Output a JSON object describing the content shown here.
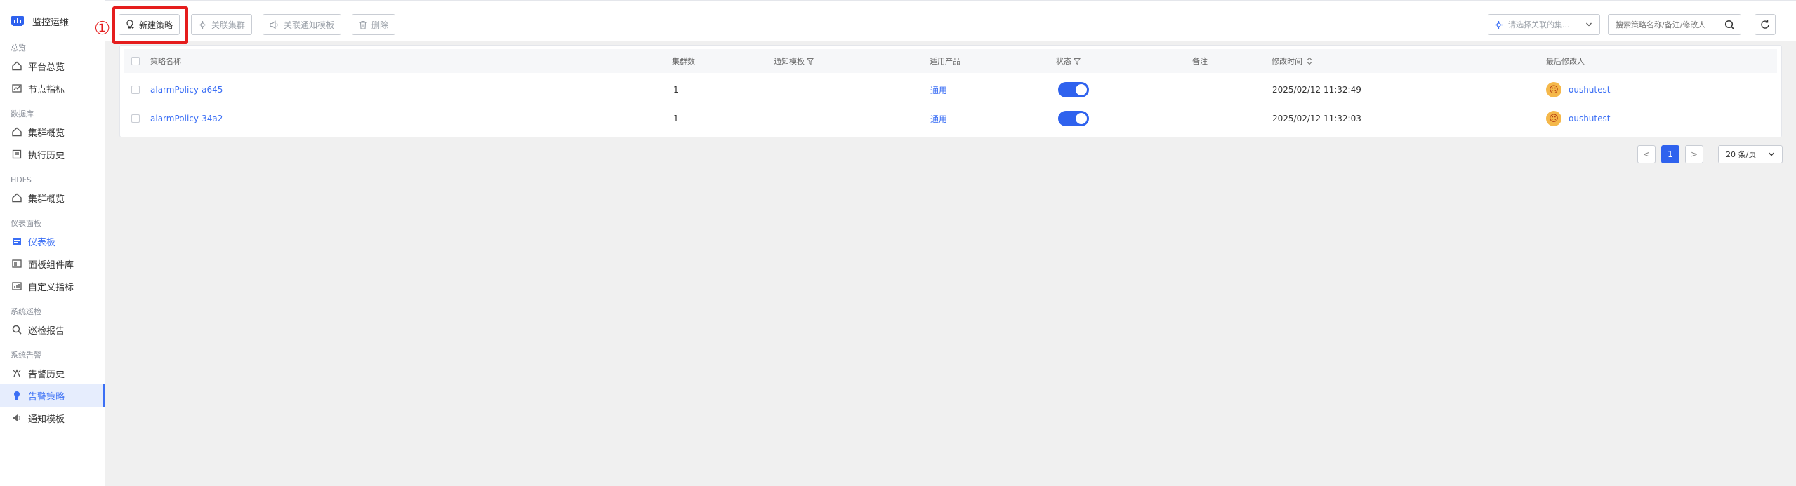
{
  "sidebar": {
    "app_title": "监控运维",
    "groups": [
      {
        "label": "总览",
        "items": [
          "平台总览",
          "节点指标"
        ]
      },
      {
        "label": "数据库",
        "items": [
          "集群概览",
          "执行历史"
        ]
      },
      {
        "label": "HDFS",
        "items": [
          "集群概览"
        ]
      },
      {
        "label": "仪表面板",
        "items": [
          "仪表板",
          "面板组件库",
          "自定义指标"
        ]
      },
      {
        "label": "系统巡检",
        "items": [
          "巡检报告"
        ]
      },
      {
        "label": "系统告警",
        "items": [
          "告警历史",
          "告警策略",
          "通知模板"
        ]
      }
    ],
    "icons": {
      "platform_overview": "home-icon",
      "node_metrics": "chart-icon",
      "cluster_overview": "home-icon",
      "exec_history": "history-icon",
      "dashboard": "dashboard-icon",
      "panel_library": "library-icon",
      "custom_metrics": "metrics-icon",
      "inspection_report": "search-report-icon",
      "alarm_history": "alarm-history-icon",
      "alarm_policy": "bulb-icon",
      "notify_template": "speaker-icon"
    }
  },
  "annotation": {
    "marker": "①"
  },
  "toolbar": {
    "new_policy": "新建策略",
    "link_cluster": "关联集群",
    "link_template": "关联通知模板",
    "delete": "删除",
    "cluster_select_placeholder": "请选择关联的集...",
    "search_placeholder": "搜索策略名称/备注/修改人"
  },
  "table": {
    "columns": {
      "name": "策略名称",
      "clusters": "集群数",
      "template": "通知模板",
      "product": "适用产品",
      "status": "状态",
      "remark": "备注",
      "modified": "修改时间",
      "modifier": "最后修改人"
    },
    "rows": [
      {
        "name": "alarmPolicy-a645",
        "clusters": "1",
        "template": "--",
        "product": "通用",
        "status": true,
        "remark": "",
        "modified": "2025/02/12 11:32:49",
        "modifier": "oushutest"
      },
      {
        "name": "alarmPolicy-34a2",
        "clusters": "1",
        "template": "--",
        "product": "通用",
        "status": true,
        "remark": "",
        "modified": "2025/02/12 11:32:03",
        "modifier": "oushutest"
      }
    ]
  },
  "pagination": {
    "prev": "<",
    "current": "1",
    "next": ">",
    "page_size": "20 条/页"
  },
  "colors": {
    "accent": "#3b6ff5",
    "toggle_on": "#2f62ee",
    "highlight": "#e51d1d",
    "selected_bg": "#e6edfd"
  }
}
